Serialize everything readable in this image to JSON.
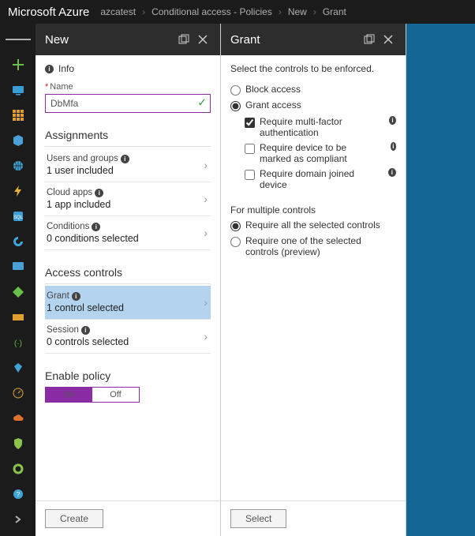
{
  "brand": "Microsoft Azure",
  "breadcrumb": [
    "azcatest",
    "Conditional access - Policies",
    "New",
    "Grant"
  ],
  "blade_new": {
    "title": "New",
    "info": "Info",
    "name_label": "Name",
    "name_value": "DbMfa",
    "assignments_title": "Assignments",
    "rows": {
      "users": {
        "label": "Users and groups",
        "value": "1 user included"
      },
      "apps": {
        "label": "Cloud apps",
        "value": "1 app included"
      },
      "cond": {
        "label": "Conditions",
        "value": "0 conditions selected"
      }
    },
    "access_title": "Access controls",
    "access_rows": {
      "grant": {
        "label": "Grant",
        "value": "1 control selected"
      },
      "session": {
        "label": "Session",
        "value": "0 controls selected"
      }
    },
    "enable_title": "Enable policy",
    "toggle_on": "On",
    "toggle_off": "Off",
    "create_btn": "Create"
  },
  "blade_grant": {
    "title": "Grant",
    "lead": "Select the controls to be enforced.",
    "radio_block": "Block access",
    "radio_grant": "Grant access",
    "cb_mfa": "Require multi-factor authentication",
    "cb_compliant": "Require device to be marked as compliant",
    "cb_domain": "Require domain joined device",
    "multi_title": "For multiple controls",
    "radio_all": "Require all the selected controls",
    "radio_one": "Require one of the selected controls (preview)",
    "select_btn": "Select"
  }
}
